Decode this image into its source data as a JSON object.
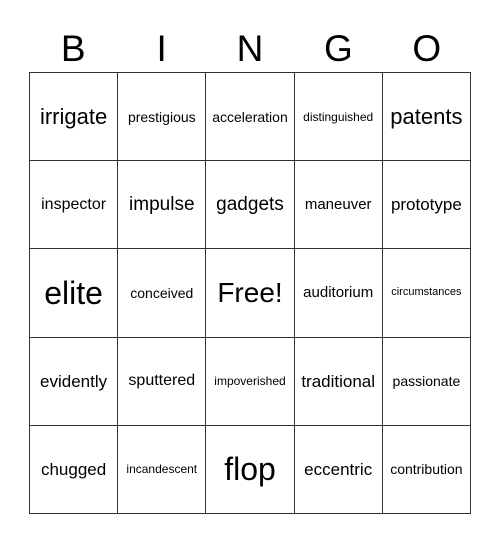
{
  "header": {
    "letters": [
      "B",
      "I",
      "N",
      "G",
      "O"
    ]
  },
  "board": {
    "rows": [
      [
        "irrigate",
        "prestigious",
        "acceleration",
        "distinguished",
        "patents"
      ],
      [
        "inspector",
        "impulse",
        "gadgets",
        "maneuver",
        "prototype"
      ],
      [
        "elite",
        "conceived",
        "Free!",
        "auditorium",
        "circumstances"
      ],
      [
        "evidently",
        "sputtered",
        "impoverished",
        "traditional",
        "passionate"
      ],
      [
        "chugged",
        "incandescent",
        "flop",
        "eccentric",
        "contribution"
      ]
    ],
    "free_space": "Free!"
  },
  "colors": {
    "background": "#ffffff",
    "text": "#000000",
    "grid_line": "#333333"
  }
}
